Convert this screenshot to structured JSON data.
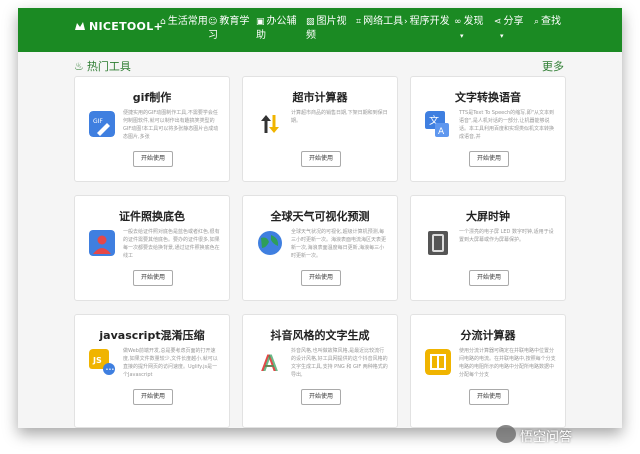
{
  "brand": {
    "name": "NICETOOL",
    "plus": "+"
  },
  "nav": [
    {
      "label": "生活常用",
      "icon": "home-icon"
    },
    {
      "label": "教育学习",
      "icon": "user-icon"
    },
    {
      "label": "办公辅助",
      "icon": "briefcase-icon"
    },
    {
      "label": "图片视频",
      "icon": "image-icon"
    },
    {
      "label": "网络工具",
      "icon": "network-icon"
    },
    {
      "label": "程序开发",
      "icon": "code-icon"
    },
    {
      "label": "发现",
      "icon": "glasses-icon"
    },
    {
      "label": "分享",
      "icon": "share-icon"
    },
    {
      "label": "查找",
      "icon": "search-icon"
    }
  ],
  "section": {
    "title": "热门工具",
    "more": "更多"
  },
  "cards": [
    {
      "title": "gif制作",
      "desc": "便捷实用的GIF动图制作工具,不需要学会任何制图软件,就可以制作出有趣搞笑类型的GIF动图!本工具可以将多张静态图片合成动态图片,多张",
      "button": "开始使用",
      "icon": "gif-icon",
      "color": "#3f7fe0"
    },
    {
      "title": "超市计算器",
      "desc": "计算超市商品的销售日期,下架日期和到保日期。",
      "button": "开始使用",
      "icon": "sort-arrows-icon",
      "color": "#f0b400"
    },
    {
      "title": "文字转换语音",
      "desc": "TTS是Text To Speech的缩写,即\"从文本到语音\",是人机对话的一部分,让机器能够说话。本工具利用百度和实现类似机文本转换成语音,并",
      "button": "开始使用",
      "icon": "text-to-speech-icon",
      "color": "#3f7fe0"
    },
    {
      "title": "证件照换底色",
      "desc": "一般去给证件照对底色是蓝色或者红色,很有的证件需要其他底色。要办的证件很多,如果每一次都要去给换背景,通过证件照换底色在线工",
      "button": "开始使用",
      "icon": "id-photo-icon",
      "color": "#3f7fe0"
    },
    {
      "title": "全球天气可视化预测",
      "desc": "全球天气状况的可视化,超级计算机预测,每三小时更新一次。海浪表面电流海区天表更新一次,海浪表面温度每日更新,海浪每三小时更新一次。",
      "button": "开始使用",
      "icon": "globe-icon",
      "color": "#2e9e5a"
    },
    {
      "title": "大屏时钟",
      "desc": "一个漂亮的电子屏 LED 数字时钟,适用于设置到大屏幕或作为屏幕保护。",
      "button": "开始使用",
      "icon": "digit-clock-icon",
      "color": "#6b6b6b"
    },
    {
      "title": "javascript混淆压缩",
      "desc": "做Web前端开发,总是要考虑页面的打开速度,如果文件数量较少,文件长度越小,就可以直接的提升网页的访问速度。Uglify.js是一个Javascript",
      "button": "开始使用",
      "icon": "js-icon",
      "color": "#f0b400"
    },
    {
      "title": "抖音风格的文字生成",
      "desc": "抖音风格,也叫做故障风格,是最近比较流行的设计风格,好工具网提供的这个抖音风格的文字生成工具,支持 PNG 和 GIF 两种格式的导出,",
      "button": "开始使用",
      "icon": "glitch-text-icon",
      "color": "#e54848"
    },
    {
      "title": "分流计算器",
      "desc": "使用分流计算器可确定在并联电路中位置分间电路的电流。在并联电路中,按照每个分支电路的电阻所示的电路中分配所电路数据中分配每个分支",
      "button": "开始使用",
      "icon": "current-divider-icon",
      "color": "#f0b400"
    }
  ],
  "watermark": "悟空问答"
}
